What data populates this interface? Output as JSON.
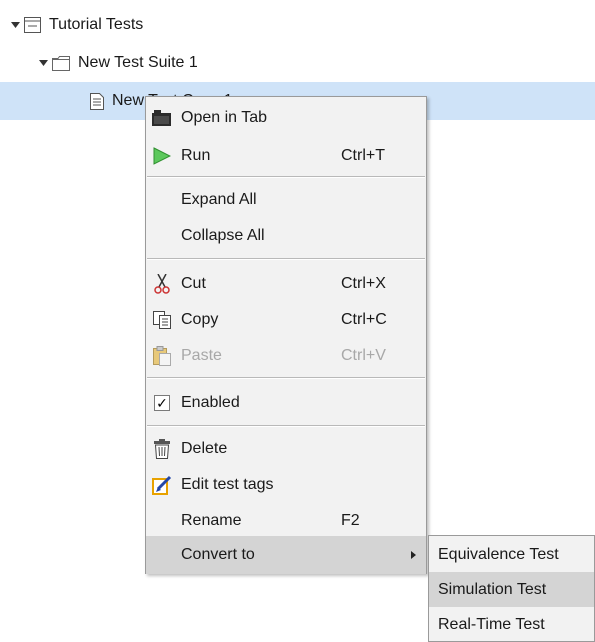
{
  "tree": {
    "root": {
      "label": "Tutorial Tests"
    },
    "suite": {
      "label": "New Test Suite 1"
    },
    "case": {
      "label": "New Test Case 1"
    }
  },
  "context_menu": {
    "items": [
      {
        "label": "Open in Tab",
        "shortcut": "",
        "icon": "open-in-tab-icon"
      },
      {
        "label": "Run",
        "shortcut": "Ctrl+T",
        "icon": "run-icon"
      },
      {
        "label": "Expand All",
        "shortcut": ""
      },
      {
        "label": "Collapse All",
        "shortcut": ""
      },
      {
        "label": "Cut",
        "shortcut": "Ctrl+X",
        "icon": "cut-icon"
      },
      {
        "label": "Copy",
        "shortcut": "Ctrl+C",
        "icon": "copy-icon"
      },
      {
        "label": "Paste",
        "shortcut": "Ctrl+V",
        "icon": "paste-icon",
        "disabled": true
      },
      {
        "label": "Enabled",
        "shortcut": "",
        "icon": "checkbox-checked-icon",
        "checked": true
      },
      {
        "label": "Delete",
        "shortcut": "",
        "icon": "trash-icon"
      },
      {
        "label": "Edit test tags",
        "shortcut": "",
        "icon": "edit-tags-icon"
      },
      {
        "label": "Rename",
        "shortcut": "F2"
      },
      {
        "label": "Convert to",
        "shortcut": "",
        "has_submenu": true,
        "highlighted": true
      }
    ]
  },
  "submenu": {
    "items": [
      {
        "label": "Equivalence Test"
      },
      {
        "label": "Simulation Test",
        "highlighted": true
      },
      {
        "label": "Real-Time Test"
      }
    ]
  },
  "colors": {
    "selection": "#cfe3f8",
    "menu_bg": "#f2f2f2",
    "menu_hover": "#d4d4d4",
    "run_green": "#3fae3f",
    "disabled_text": "#a8a8a8"
  }
}
